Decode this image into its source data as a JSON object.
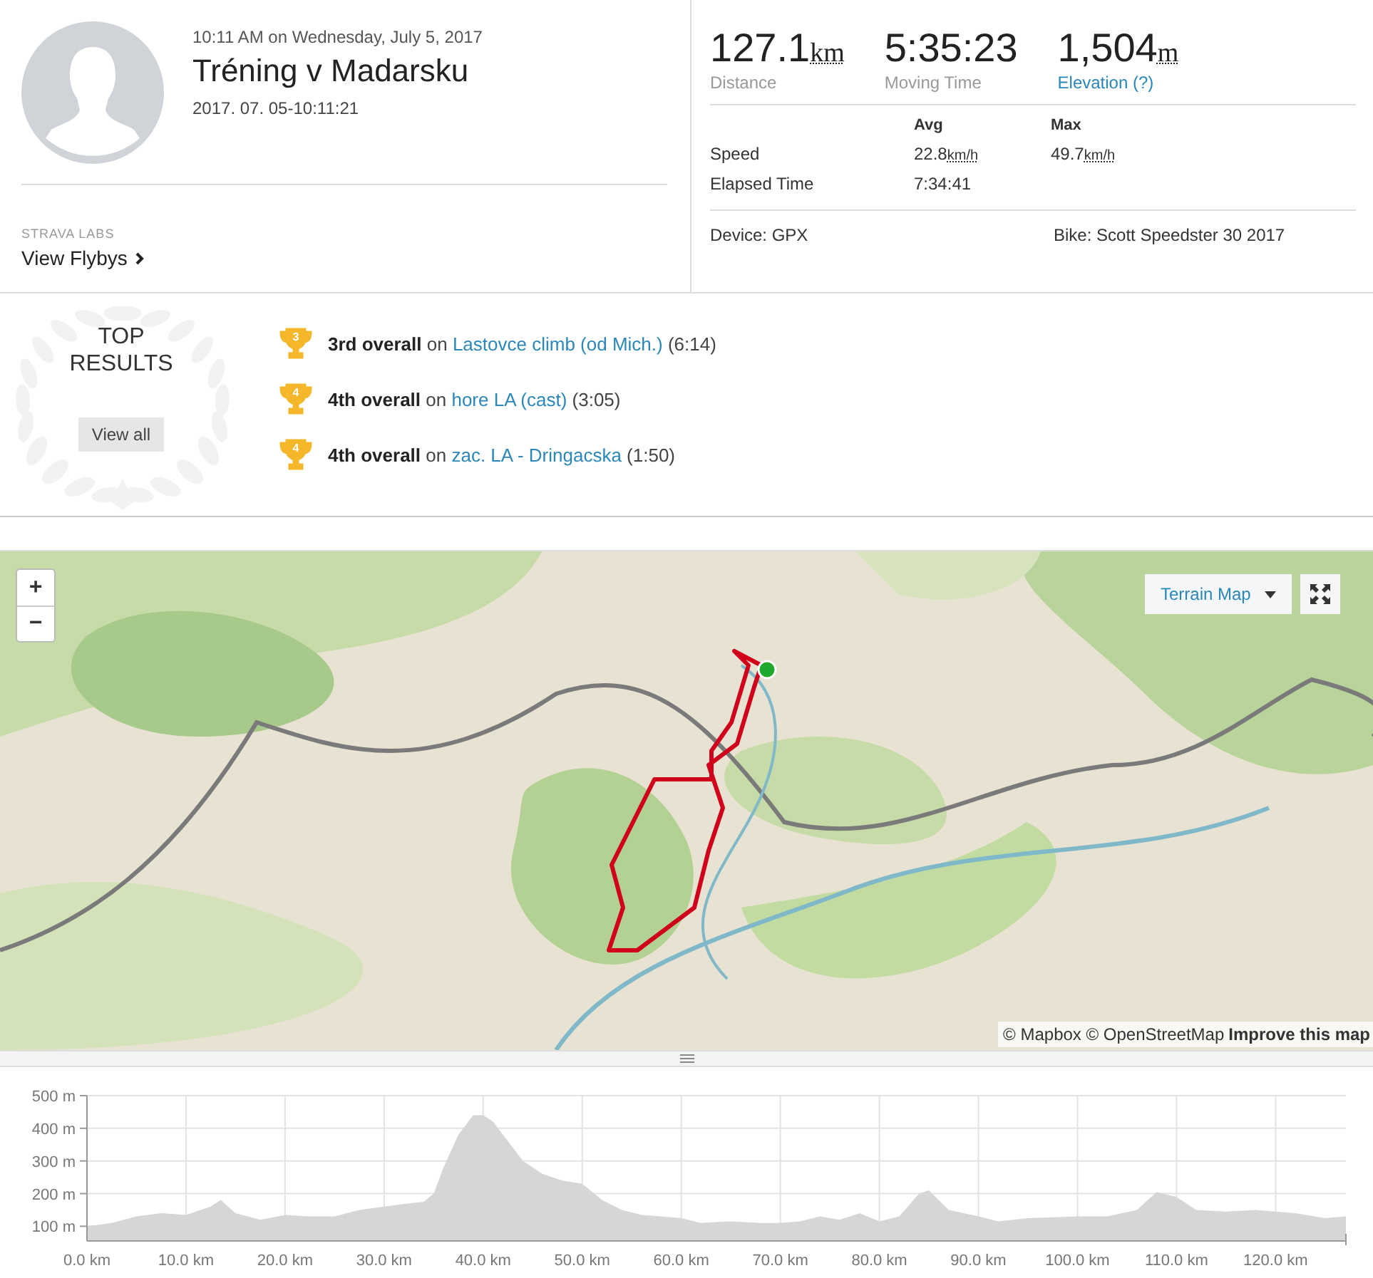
{
  "header": {
    "date_line": "10:11 AM on Wednesday, July 5, 2017",
    "title": "Tréning v Madarsku",
    "timestamp": "2017. 07. 05-10:11:21",
    "labs_label": "STRAVA LABS",
    "flybys_link": "View Flybys",
    "stats": [
      {
        "value": "127.1",
        "unit": "km",
        "label": "Distance",
        "kind": "plain"
      },
      {
        "value": "5:35:23",
        "label": "Moving Time",
        "kind": "plain"
      },
      {
        "value": "1,504",
        "unit": "m",
        "label": "Elevation (?)",
        "kind": "link"
      }
    ],
    "table": {
      "columns": [
        "Avg",
        "Max"
      ],
      "rows": [
        {
          "label": "Speed",
          "cells": [
            {
              "value": "22.8",
              "unit": "km/h"
            },
            {
              "value": "49.7",
              "unit": "km/h"
            }
          ]
        },
        {
          "label": "Elapsed Time",
          "cells": [
            {
              "value": "7:34:41"
            }
          ]
        }
      ]
    },
    "device": "Device: GPX",
    "bike": "Bike: Scott Speedster 30 2017"
  },
  "top_results": {
    "title": "TOP RESULTS",
    "button": "View all",
    "items": [
      {
        "rank": "3",
        "text": "**3rd overall** on",
        "segment": "Lastovce climb (od Mich.)",
        "time": "(6:14)"
      },
      {
        "rank": "4",
        "text": "**4th overall** on",
        "segment": "hore LA (cast)",
        "time": "(3:05)"
      },
      {
        "rank": "4",
        "text": "**4th overall** on",
        "segment": "zac. LA - Dringacska",
        "time": "(1:50)"
      }
    ]
  },
  "map": {
    "kind": "picture",
    "zoom_in": "+",
    "zoom_out": "−",
    "layer": "Terrain Map",
    "attribution": "© Mapbox © OpenStreetMap",
    "improve": "Improve this map"
  },
  "elevation": {
    "chart_data": {
      "type": "area",
      "xlim": [
        0,
        127.1
      ],
      "ylim": [
        55,
        500
      ],
      "xticks": [
        {
          "value": 0,
          "label": "0.0 km"
        },
        {
          "value": 10,
          "label": "10.0 km"
        },
        {
          "value": 20,
          "label": "20.0 km"
        },
        {
          "value": 30,
          "label": "30.0 km"
        },
        {
          "value": 40,
          "label": "40.0 km"
        },
        {
          "value": 50,
          "label": "50.0 km"
        },
        {
          "value": 60,
          "label": "60.0 km"
        },
        {
          "value": 70,
          "label": "70.0 km"
        },
        {
          "value": 80,
          "label": "80.0 km"
        },
        {
          "value": 90,
          "label": "90.0 km"
        },
        {
          "value": 100,
          "label": "100.0 km"
        },
        {
          "value": 110,
          "label": "110.0 km"
        },
        {
          "value": 120,
          "label": "120.0 km"
        }
      ],
      "yticks": [
        {
          "value": 100,
          "label": "100 m"
        },
        {
          "value": 200,
          "label": "200 m"
        },
        {
          "value": 300,
          "label": "300 m"
        },
        {
          "value": 400,
          "label": "400 m"
        },
        {
          "value": 500,
          "label": "500 m"
        }
      ],
      "x": [
        0,
        2.5,
        5,
        7.5,
        10,
        12.5,
        13.5,
        15,
        17.5,
        20,
        22.5,
        25,
        27.5,
        30,
        32.5,
        34,
        35,
        36,
        37.5,
        39,
        40,
        41,
        42,
        44,
        46,
        48,
        50,
        52,
        54,
        56,
        58,
        60,
        62,
        65,
        68,
        70,
        72,
        74,
        76,
        78,
        80,
        82,
        84,
        85,
        87,
        90,
        92,
        95,
        100,
        103,
        106,
        108,
        110,
        112,
        115,
        118,
        120,
        122,
        125,
        127.1
      ],
      "grid": true,
      "series": [
        {
          "color": "#d6d6d6",
          "values": [
            100,
            110,
            130,
            140,
            135,
            160,
            180,
            140,
            120,
            135,
            130,
            130,
            150,
            160,
            170,
            175,
            200,
            280,
            380,
            440,
            440,
            420,
            380,
            300,
            260,
            240,
            230,
            180,
            150,
            135,
            130,
            125,
            110,
            115,
            110,
            110,
            115,
            130,
            120,
            140,
            115,
            130,
            200,
            210,
            150,
            130,
            115,
            125,
            130,
            130,
            150,
            205,
            190,
            150,
            145,
            150,
            145,
            140,
            125,
            130
          ]
        }
      ]
    }
  }
}
